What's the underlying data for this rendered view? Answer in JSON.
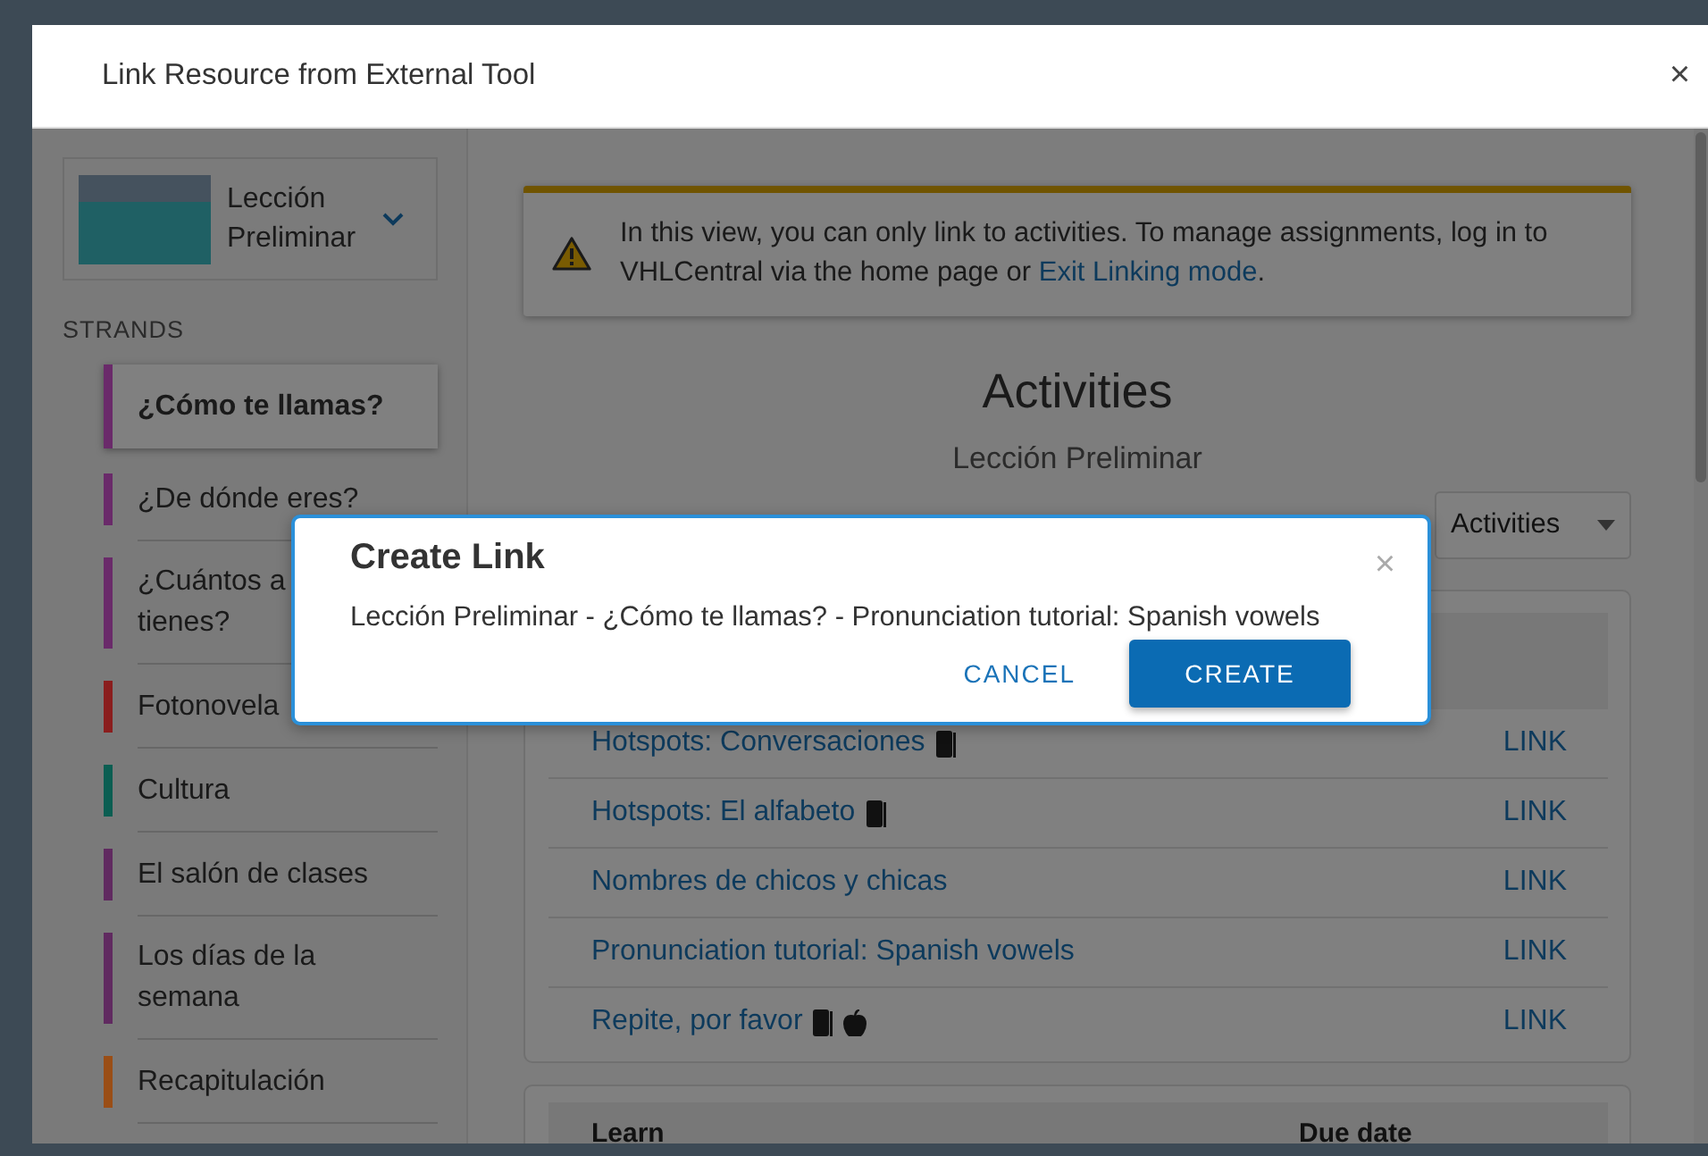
{
  "window": {
    "title": "Link Resource from External Tool",
    "close": "×"
  },
  "sidebar": {
    "lesson": {
      "title": "Lección Preliminar"
    },
    "heading": "STRANDS",
    "items": [
      {
        "lines": [
          "¿Cómo te llamas?"
        ],
        "color": "#6a2a6a",
        "selected": true
      },
      {
        "lines": [
          "¿De dónde eres?"
        ],
        "color": "#6a2a6a",
        "selected": false
      },
      {
        "lines": [
          "¿Cuántos a",
          "tienes?"
        ],
        "color": "#6a2a6a",
        "selected": false
      },
      {
        "lines": [
          "Fotonovela"
        ],
        "color": "#8a1e1e",
        "selected": false
      },
      {
        "lines": [
          "Cultura"
        ],
        "color": "#0b5e52",
        "selected": false
      },
      {
        "lines": [
          "El salón de clases"
        ],
        "color": "#602a60",
        "selected": false
      },
      {
        "lines": [
          "Los días de la",
          "semana"
        ],
        "color": "#602a60",
        "selected": false
      },
      {
        "lines": [
          "Recapitulación"
        ],
        "color": "#9a4e16",
        "selected": false
      }
    ]
  },
  "notice": {
    "text": "In this view, you can only link to activities. To manage assignments, log in to VHLCentral via the home page or ",
    "link": "Exit Linking mode",
    "after": "."
  },
  "heading": "Activities",
  "subheading": "Lección Preliminar",
  "filter": {
    "value": "Activities"
  },
  "activities": [
    {
      "title": "Hotspots: Conversaciones",
      "book_icon": true,
      "apple_icon": false,
      "action": "LINK"
    },
    {
      "title": "Hotspots: El alfabeto",
      "book_icon": true,
      "apple_icon": false,
      "action": "LINK"
    },
    {
      "title": "Nombres de chicos y chicas",
      "book_icon": false,
      "apple_icon": false,
      "action": "LINK"
    },
    {
      "title": "Pronunciation tutorial: Spanish vowels",
      "book_icon": false,
      "apple_icon": false,
      "action": "LINK"
    },
    {
      "title": "Repite, por favor",
      "book_icon": true,
      "apple_icon": true,
      "action": "LINK"
    }
  ],
  "learn_table": {
    "columns": [
      "Learn",
      "Due date"
    ]
  },
  "dialog": {
    "title": "Create Link",
    "close": "×",
    "message": "Lección Preliminar - ¿Cómo te llamas? - Pronunciation tutorial: Spanish vowels",
    "buttons": [
      {
        "label": "CANCEL",
        "kind": "secondary"
      },
      {
        "label": "CREATE",
        "kind": "primary"
      }
    ]
  }
}
